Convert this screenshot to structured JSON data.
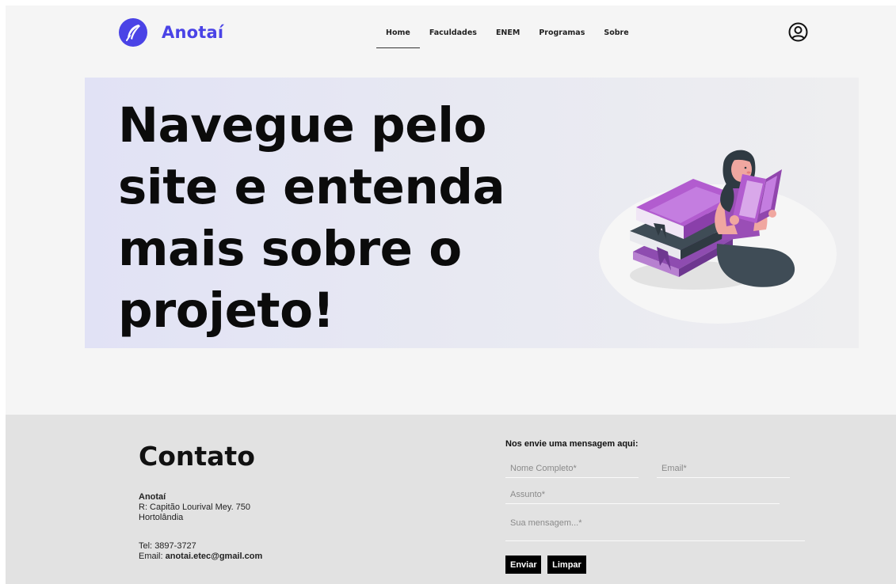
{
  "brand": {
    "name": "Anotaí",
    "color": "#4a43e6",
    "icon": "feather-icon"
  },
  "nav": {
    "items": [
      {
        "label": "Home",
        "active": true
      },
      {
        "label": "Faculdades",
        "active": false
      },
      {
        "label": "ENEM",
        "active": false
      },
      {
        "label": "Programas",
        "active": false
      },
      {
        "label": "Sobre",
        "active": false
      }
    ],
    "user_icon": "user-circle-icon"
  },
  "hero": {
    "title": "Navegue pelo site e entenda mais sobre o projeto!",
    "illustration": "girl-reading-books-illustration",
    "accent_color": "#a45fc7"
  },
  "footer": {
    "contact_title": "Contato",
    "org_name": "Anotaí",
    "address_line1": "R: Capitão Lourival Mey. 750",
    "address_line2": "Hortolândia",
    "tel_label": "Tel:",
    "tel_value": "3897-3727",
    "email_label": "Email:",
    "email_value": "anotai.etec@gmail.com"
  },
  "form": {
    "heading": "Nos envie uma mensagem aqui:",
    "name_placeholder": "Nome Completo*",
    "email_placeholder": "Email*",
    "subject_placeholder": "Assunto*",
    "message_placeholder": "Sua mensagem...*",
    "send_label": "Enviar",
    "clear_label": "Limpar"
  }
}
